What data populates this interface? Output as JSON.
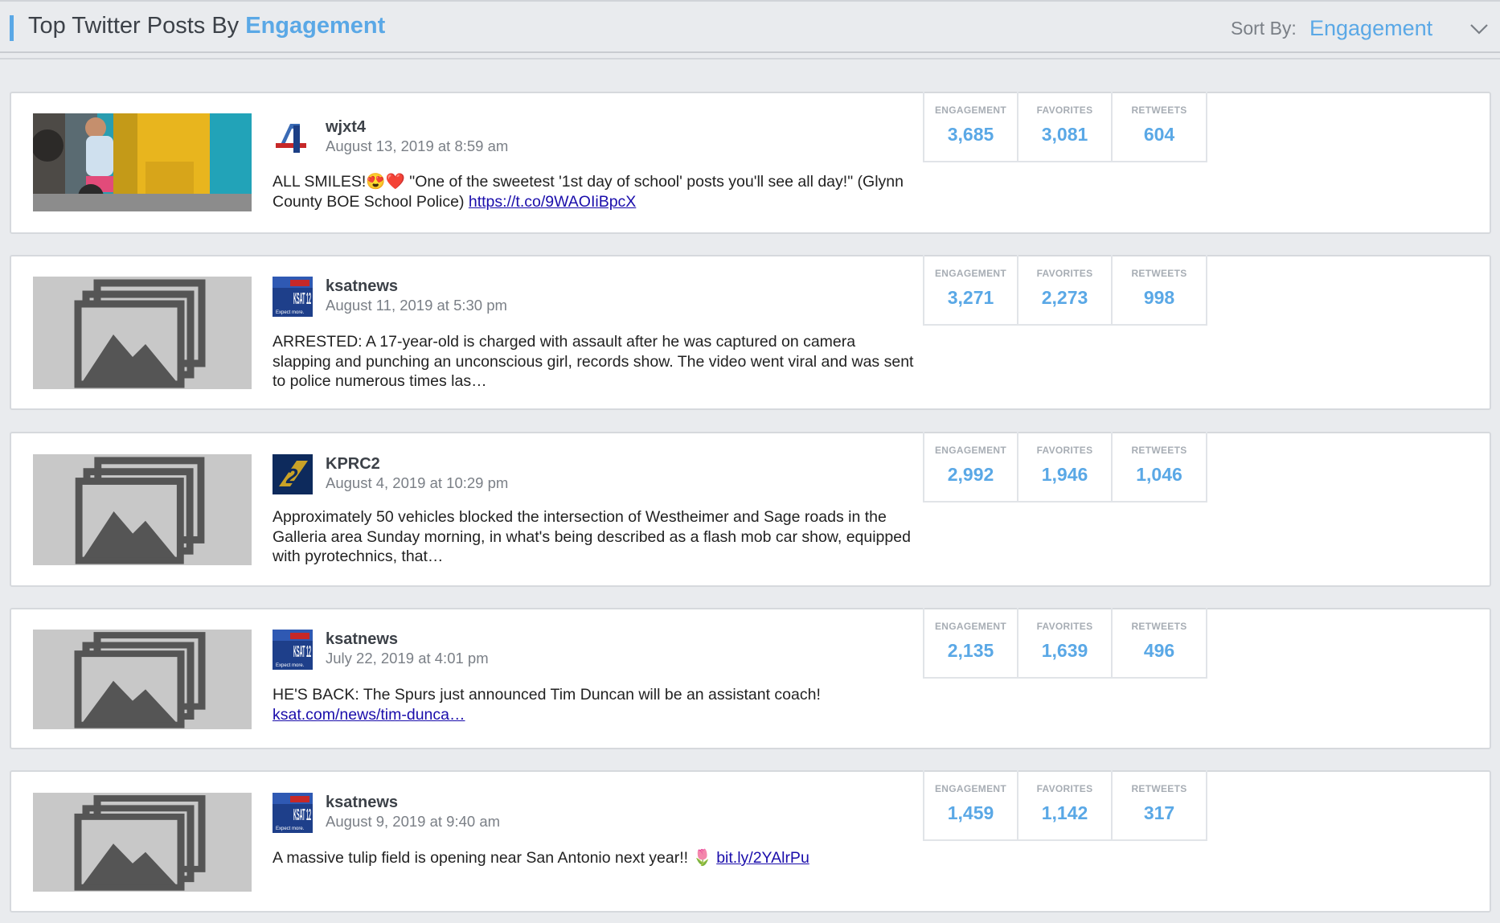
{
  "header": {
    "title_prefix": "Top Twitter Posts By ",
    "title_highlight": "Engagement",
    "sort_label": "Sort By:",
    "sort_value": "Engagement"
  },
  "stat_labels": {
    "engagement": "ENGAGEMENT",
    "favorites": "FAVORITES",
    "retweets": "RETWEETS"
  },
  "posts": [
    {
      "handle": "wjxt4",
      "date": "August 13, 2019 at 8:59 am",
      "text": "ALL SMILES!😍❤️ \"One of the sweetest '1st day of school' posts you'll see all day!\" (Glynn County BOE School Police) ",
      "link": "https://t.co/9WAOIiBpcX",
      "engagement": "3,685",
      "favorites": "3,081",
      "retweets": "604"
    },
    {
      "handle": "ksatnews",
      "date": "August 11, 2019 at 5:30 pm",
      "text": "ARRESTED: A 17-year-old is charged with assault after he was captured on camera slapping and punching an unconscious girl, records show. The video went viral and was sent to police numerous times las…",
      "link": "",
      "engagement": "3,271",
      "favorites": "2,273",
      "retweets": "998"
    },
    {
      "handle": "KPRC2",
      "date": "August 4, 2019 at 10:29 pm",
      "text": "Approximately 50 vehicles blocked the intersection of Westheimer and Sage roads in the Galleria area Sunday morning, in what's being described as a flash mob car show, equipped with pyrotechnics, that…",
      "link": "",
      "engagement": "2,992",
      "favorites": "1,946",
      "retweets": "1,046"
    },
    {
      "handle": "ksatnews",
      "date": "July 22, 2019 at 4:01 pm",
      "text": "HE'S BACK: The Spurs just announced Tim Duncan will be an assistant coach! ",
      "link": "ksat.com/news/tim-dunca…",
      "engagement": "2,135",
      "favorites": "1,639",
      "retweets": "496"
    },
    {
      "handle": "ksatnews",
      "date": "August 9, 2019 at 9:40 am",
      "text": "A massive tulip field is opening near San Antonio next year!! 🌷 ",
      "link": "bit.ly/2YAlrPu",
      "engagement": "1,459",
      "favorites": "1,142",
      "retweets": "317"
    }
  ],
  "avatars": {
    "wjxt4": "WJXT 4",
    "ksat": "KSAT 12",
    "ksat_tagline": "Expect more.",
    "kprc": "2"
  },
  "colors": {
    "accent": "#5aa8e6",
    "background": "#e9ebee",
    "card": "#ffffff",
    "placeholder": "#c8c8c8",
    "placeholder_icon": "#555555"
  }
}
